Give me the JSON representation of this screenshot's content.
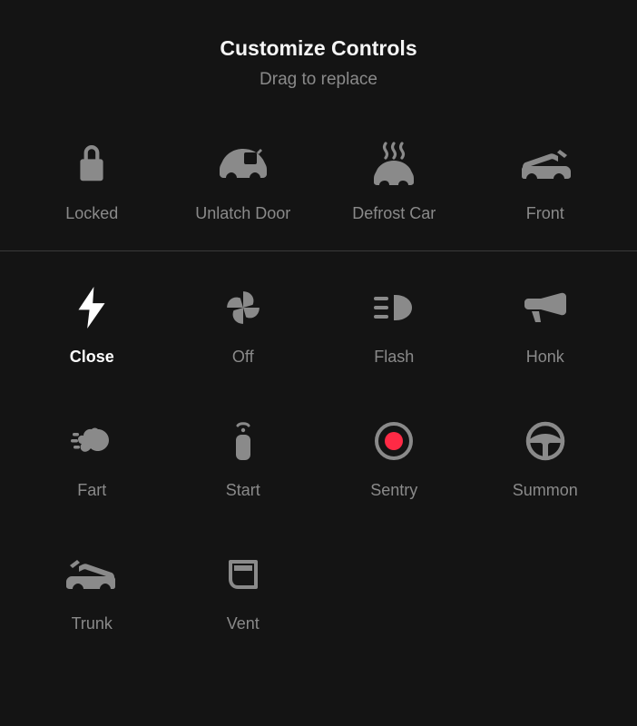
{
  "header": {
    "title": "Customize Controls",
    "subtitle": "Drag to replace"
  },
  "top_row": [
    {
      "id": "locked",
      "label": "Locked",
      "icon": "lock-icon",
      "active": false
    },
    {
      "id": "unlatch-door",
      "label": "Unlatch Door",
      "icon": "car-door-icon",
      "active": false
    },
    {
      "id": "defrost-car",
      "label": "Defrost Car",
      "icon": "defrost-icon",
      "active": false
    },
    {
      "id": "front",
      "label": "Front",
      "icon": "frunk-icon",
      "active": false
    }
  ],
  "grid": [
    {
      "id": "close",
      "label": "Close",
      "icon": "bolt-icon",
      "active": true
    },
    {
      "id": "off",
      "label": "Off",
      "icon": "fan-icon",
      "active": false
    },
    {
      "id": "flash",
      "label": "Flash",
      "icon": "headlight-icon",
      "active": false
    },
    {
      "id": "honk",
      "label": "Honk",
      "icon": "horn-icon",
      "active": false
    },
    {
      "id": "fart",
      "label": "Fart",
      "icon": "fart-icon",
      "active": false
    },
    {
      "id": "start",
      "label": "Start",
      "icon": "keyfob-icon",
      "active": false
    },
    {
      "id": "sentry",
      "label": "Sentry",
      "icon": "sentry-icon",
      "active": false
    },
    {
      "id": "summon",
      "label": "Summon",
      "icon": "steering-icon",
      "active": false
    },
    {
      "id": "trunk",
      "label": "Trunk",
      "icon": "trunk-icon",
      "active": false
    },
    {
      "id": "vent",
      "label": "Vent",
      "icon": "vent-icon",
      "active": false
    }
  ],
  "colors": {
    "accent": "#ff2a45",
    "muted": "#8a8a8a",
    "foreground": "#ffffff"
  }
}
